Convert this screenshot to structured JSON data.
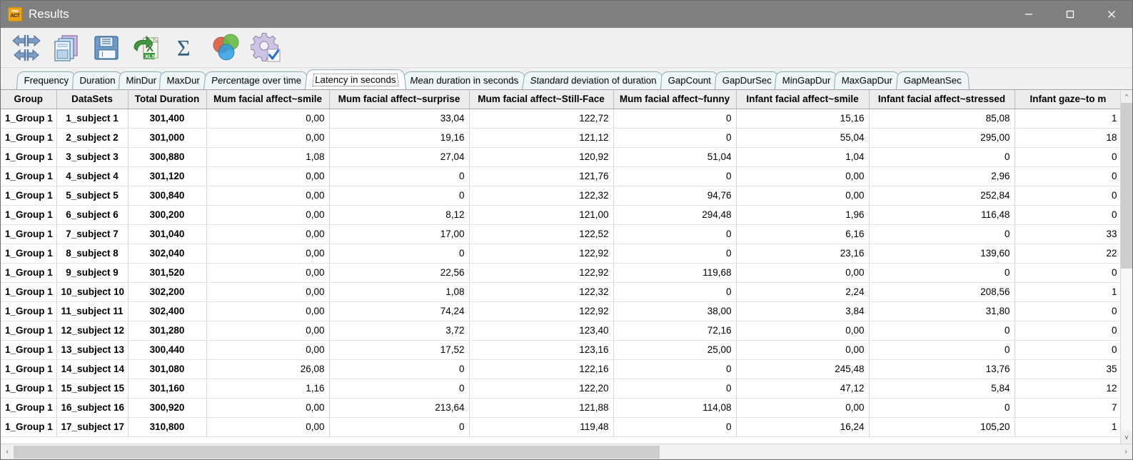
{
  "window": {
    "title": "Results",
    "app_icon": "interact-logo-icon",
    "controls": {
      "minimize": "minimize-icon",
      "maximize": "maximize-icon",
      "close": "close-icon"
    }
  },
  "toolbar": {
    "buttons": [
      {
        "name": "navigate-arrows-icon",
        "tip": "Navigate"
      },
      {
        "name": "copy-documents-icon",
        "tip": "Copy"
      },
      {
        "name": "save-floppy-icon",
        "tip": "Save"
      },
      {
        "name": "export-excel-icon",
        "tip": "Export to Excel"
      },
      {
        "name": "sigma-sum-icon",
        "tip": "Sum"
      },
      {
        "name": "venn-diagram-icon",
        "tip": "Venn"
      },
      {
        "name": "settings-gear-check-icon",
        "tip": "Settings"
      }
    ]
  },
  "tabs": {
    "selected": "Latency in seconds",
    "items": [
      "Frequency",
      "Duration",
      "MinDur",
      "MaxDur",
      "Percentage over time",
      "Latency in seconds",
      "Mean duration in seconds",
      "Standard deviation of duration",
      "GapCount",
      "GapDurSec",
      "MinGapDur",
      "MaxGapDur",
      "GapMeanSec"
    ]
  },
  "grid": {
    "columns": [
      "Group",
      "DataSets",
      "Total Duration",
      "Mum facial affect~smile",
      "Mum facial affect~surprise",
      "Mum facial affect~Still-Face",
      "Mum facial affect~funny",
      "Infant facial affect~smile",
      "Infant facial affect~stressed",
      "Infant gaze~to m"
    ],
    "selected_cell": {
      "row": 0,
      "col": 3
    },
    "rows": [
      [
        "1_Group 1",
        "1_subject 1",
        "301,400",
        "0,00",
        "33,04",
        "122,72",
        "0",
        "15,16",
        "85,08",
        "1"
      ],
      [
        "1_Group 1",
        "2_subject 2",
        "301,000",
        "0,00",
        "19,16",
        "121,12",
        "0",
        "55,04",
        "295,00",
        "18"
      ],
      [
        "1_Group 1",
        "3_subject 3",
        "300,880",
        "1,08",
        "27,04",
        "120,92",
        "51,04",
        "1,04",
        "0",
        "0"
      ],
      [
        "1_Group 1",
        "4_subject 4",
        "301,120",
        "0,00",
        "0",
        "121,76",
        "0",
        "0,00",
        "2,96",
        "0"
      ],
      [
        "1_Group 1",
        "5_subject 5",
        "300,840",
        "0,00",
        "0",
        "122,32",
        "94,76",
        "0,00",
        "252,84",
        "0"
      ],
      [
        "1_Group 1",
        "6_subject 6",
        "300,200",
        "0,00",
        "8,12",
        "121,00",
        "294,48",
        "1,96",
        "116,48",
        "0"
      ],
      [
        "1_Group 1",
        "7_subject 7",
        "301,040",
        "0,00",
        "17,00",
        "122,52",
        "0",
        "6,16",
        "0",
        "33"
      ],
      [
        "1_Group 1",
        "8_subject 8",
        "302,040",
        "0,00",
        "0",
        "122,92",
        "0",
        "23,16",
        "139,60",
        "22"
      ],
      [
        "1_Group 1",
        "9_subject 9",
        "301,520",
        "0,00",
        "22,56",
        "122,92",
        "119,68",
        "0,00",
        "0",
        "0"
      ],
      [
        "1_Group 1",
        "10_subject 10",
        "302,200",
        "0,00",
        "1,08",
        "122,32",
        "0",
        "2,24",
        "208,56",
        "1"
      ],
      [
        "1_Group 1",
        "11_subject 11",
        "302,400",
        "0,00",
        "74,24",
        "122,92",
        "38,00",
        "3,84",
        "31,80",
        "0"
      ],
      [
        "1_Group 1",
        "12_subject 12",
        "301,280",
        "0,00",
        "3,72",
        "123,40",
        "72,16",
        "0,00",
        "0",
        "0"
      ],
      [
        "1_Group 1",
        "13_subject 13",
        "300,440",
        "0,00",
        "17,52",
        "123,16",
        "25,00",
        "0,00",
        "0",
        "0"
      ],
      [
        "1_Group 1",
        "14_subject 14",
        "301,080",
        "26,08",
        "0",
        "122,16",
        "0",
        "245,48",
        "13,76",
        "35"
      ],
      [
        "1_Group 1",
        "15_subject 15",
        "301,160",
        "1,16",
        "0",
        "122,20",
        "0",
        "47,12",
        "5,84",
        "12"
      ],
      [
        "1_Group 1",
        "16_subject 16",
        "300,920",
        "0,00",
        "213,64",
        "121,88",
        "114,08",
        "0,00",
        "0",
        "7"
      ],
      [
        "1_Group 1",
        "17_subject 17",
        "310,800",
        "0,00",
        "0",
        "119,48",
        "0",
        "16,24",
        "105,20",
        "1"
      ]
    ]
  },
  "scrollbars": {
    "vertical": {
      "up": "scroll-up-icon",
      "down": "scroll-down-icon"
    },
    "horizontal": {
      "left": "scroll-left-icon",
      "right": "scroll-right-icon"
    }
  },
  "colors": {
    "titlebar": "#808080",
    "selection": "#aec6de",
    "tab_border": "#8aa8b4",
    "header_bg": "#ececec"
  }
}
